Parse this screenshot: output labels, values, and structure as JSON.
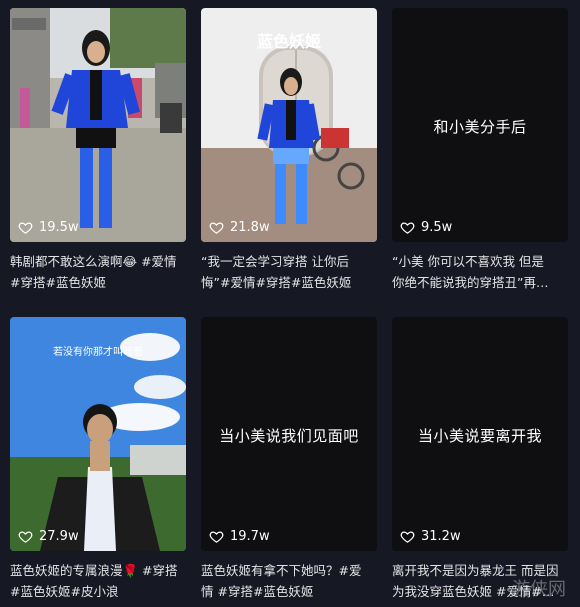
{
  "cards": [
    {
      "likes": "19.5w",
      "caption_lines": [
        "韩剧都不敢这么演啊😂 #爱情",
        "#穿搭#蓝色妖姬"
      ]
    },
    {
      "overlay_top": "蓝色妖姬",
      "likes": "21.8w",
      "caption_lines": [
        "“我一定会学习穿搭 让你后",
        "悔”#爱情#穿搭#蓝色妖姬"
      ]
    },
    {
      "overlay_center": "和小美分手后",
      "likes": "9.5w",
      "caption_lines": [
        "“小美 你可以不喜欢我 但是",
        "你绝不能说我的穿搭丑”再…"
      ]
    },
    {
      "banner": "若没有你那才叫可悲",
      "likes": "27.9w",
      "caption_lines": [
        "蓝色妖姬的专属浪漫🌹 #穿搭",
        "#蓝色妖姬#皮小浪"
      ]
    },
    {
      "overlay_center": "当小美说我们见面吧",
      "likes": "19.7w",
      "caption_lines": [
        "蓝色妖姬有拿不下她吗？#爱",
        "情 #穿搭#蓝色妖姬"
      ]
    },
    {
      "overlay_center": "当小美说要离开我",
      "likes": "31.2w",
      "caption_lines": [
        "离开我不是因为暴龙王 而是因",
        "为我没穿蓝色妖姬 #爱情#…"
      ]
    }
  ],
  "watermark": "游侠网",
  "colors": {
    "background": "#161823",
    "blazer": "#1f45d9",
    "text": "#e4e4e6"
  }
}
